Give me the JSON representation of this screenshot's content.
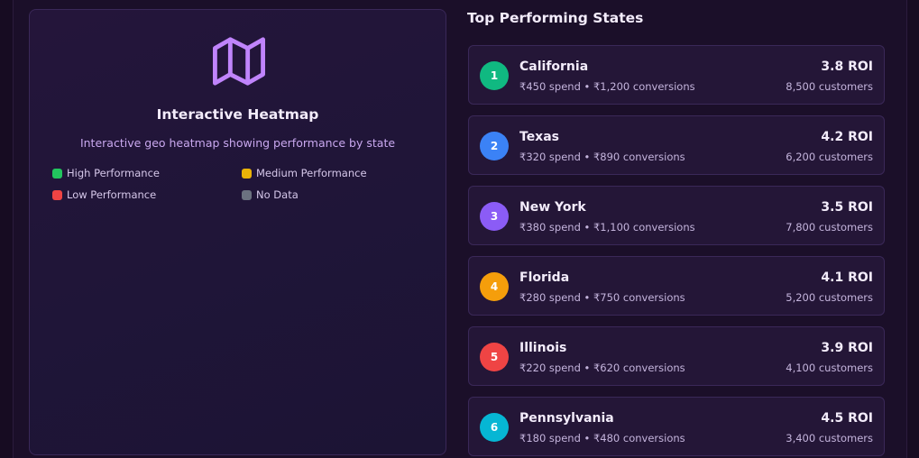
{
  "heatmap": {
    "title": "Interactive Heatmap",
    "description": "Interactive geo heatmap showing performance by state",
    "icon": "map-icon",
    "legend": [
      {
        "label": "High Performance",
        "color": "#22c55e"
      },
      {
        "label": "Medium Performance",
        "color": "#eab308"
      },
      {
        "label": "Low Performance",
        "color": "#ef4444"
      },
      {
        "label": "No Data",
        "color": "#6b7280"
      }
    ]
  },
  "top_states": {
    "title": "Top Performing States",
    "items": [
      {
        "rank": "1",
        "name": "California",
        "stats": "₹450 spend • ₹1,200 conversions",
        "roi": "3.8 ROI",
        "customers": "8,500 customers",
        "color": "#10b981"
      },
      {
        "rank": "2",
        "name": "Texas",
        "stats": "₹320 spend • ₹890 conversions",
        "roi": "4.2 ROI",
        "customers": "6,200 customers",
        "color": "#3b82f6"
      },
      {
        "rank": "3",
        "name": "New York",
        "stats": "₹380 spend • ₹1,100 conversions",
        "roi": "3.5 ROI",
        "customers": "7,800 customers",
        "color": "#8b5cf6"
      },
      {
        "rank": "4",
        "name": "Florida",
        "stats": "₹280 spend • ₹750 conversions",
        "roi": "4.1 ROI",
        "customers": "5,200 customers",
        "color": "#f59e0b"
      },
      {
        "rank": "5",
        "name": "Illinois",
        "stats": "₹220 spend • ₹620 conversions",
        "roi": "3.9 ROI",
        "customers": "4,100 customers",
        "color": "#ef4444"
      },
      {
        "rank": "6",
        "name": "Pennsylvania",
        "stats": "₹180 spend • ₹480 conversions",
        "roi": "4.5 ROI",
        "customers": "3,400 customers",
        "color": "#06b6d4"
      }
    ]
  },
  "colors": {
    "accent": "#c084fc"
  }
}
